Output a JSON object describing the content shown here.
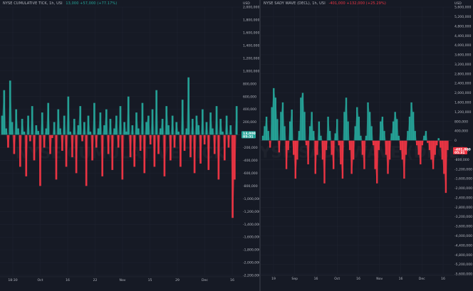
{
  "colors": {
    "up": "#26a69a",
    "down": "#f23645",
    "background": "#161a25",
    "grid": "#1f2330",
    "text": "#b2b5be"
  },
  "panes": [
    {
      "id": "left",
      "legend_name": "NYSE CUMULATIVE TICK, 1h, USI",
      "legend_values": "13,000  +57,000 (+77.17%)",
      "legend_color": "#26a69a",
      "currency": "USD",
      "watermark": "NYSE CUMULATIVE TICK",
      "price_badge": {
        "value": 13000,
        "text": "13,000",
        "sub": "05:31",
        "color": "#26a69a"
      },
      "x_ticks": [
        "18:30",
        "Oct",
        "16",
        "22",
        "Nov",
        "15",
        "29",
        "Dec",
        "16"
      ]
    },
    {
      "id": "right",
      "legend_name": "NYSE SADY WAVE (DECL), 1h, USI",
      "legend_values": "-401,000  +132,000 (+25.29%)",
      "legend_color": "#f23645",
      "currency": "USD",
      "watermark": "NYSE SADY WAVE (DECL)",
      "price_badge": {
        "value": -401000,
        "text": "-401,000",
        "sub": "05:31",
        "color": "#f23645"
      },
      "x_ticks": [
        "19",
        "Sep",
        "16",
        "Oct",
        "16",
        "Nov",
        "16",
        "Dec",
        "16"
      ]
    }
  ],
  "chart_data": [
    {
      "type": "area",
      "title": "NYSE CUMULATIVE TICK, 1h, USI",
      "ylabel": "USD",
      "ylim": [
        -2200000,
        2000000
      ],
      "y_ticks": [
        2000000,
        1800000,
        1600000,
        1400000,
        1200000,
        1000000,
        800000,
        600000,
        400000,
        200000,
        0,
        -200000,
        -400000,
        -600000,
        -800000,
        -1000000,
        -1200000,
        -1400000,
        -1600000,
        -1800000,
        -2000000,
        -2200000
      ],
      "y_tick_labels": [
        "2,000,000",
        "1,800,000",
        "1,600,000",
        "1,400,000",
        "1,200,000",
        "1,000,000",
        "800,000",
        "600,000",
        "400,000",
        "200,000",
        "0",
        "-200,000",
        "-400,000",
        "-600,000",
        "-800,000",
        "-1,000,000",
        "-1,200,000",
        "-1,400,000",
        "-1,600,000",
        "-1,800,000",
        "-2,000,000",
        "-2,200,000"
      ],
      "x_tick_labels": [
        "18:30",
        "Oct",
        "16",
        "22",
        "Nov",
        "15",
        "29",
        "Dec",
        "16"
      ],
      "series": [
        {
          "values": [
            300000,
            700000,
            100000,
            -200000,
            850000,
            200000,
            -300000,
            400000,
            100000,
            -500000,
            250000,
            50000,
            -650000,
            300000,
            -100000,
            450000,
            -400000,
            150000,
            60000,
            -800000,
            350000,
            -200000,
            100000,
            500000,
            -300000,
            -50000,
            200000,
            -700000,
            400000,
            100000,
            -250000,
            300000,
            -500000,
            600000,
            50000,
            -350000,
            250000,
            -600000,
            150000,
            450000,
            -100000,
            200000,
            -800000,
            300000,
            50000,
            -400000,
            500000,
            -200000,
            100000,
            350000,
            -650000,
            150000,
            400000,
            -300000,
            250000,
            -550000,
            100000,
            300000,
            -200000,
            450000,
            -700000,
            200000,
            50000,
            600000,
            -350000,
            150000,
            -500000,
            350000,
            100000,
            -250000,
            500000,
            -600000,
            200000,
            300000,
            -150000,
            400000,
            -500000,
            700000,
            -300000,
            100000,
            250000,
            -650000,
            450000,
            150000,
            -400000,
            300000,
            -200000,
            200000,
            50000,
            -500000,
            550000,
            -250000,
            100000,
            900000,
            -350000,
            250000,
            -600000,
            300000,
            150000,
            -450000,
            400000,
            -150000,
            200000,
            -550000,
            350000,
            100000,
            -300000,
            450000,
            -700000,
            250000,
            50000,
            -400000,
            300000,
            -200000,
            150000,
            -1300000,
            -700000,
            450000
          ]
        }
      ]
    },
    {
      "type": "area",
      "title": "NYSE SADY WAVE (DECL), 1h, USI",
      "ylabel": "USD",
      "ylim": [
        -5600000,
        5600000
      ],
      "y_ticks": [
        5600000,
        5200000,
        4800000,
        4400000,
        4000000,
        3600000,
        3200000,
        2800000,
        2400000,
        2000000,
        1600000,
        1200000,
        800000,
        400000,
        0,
        -400000,
        -800000,
        -1200000,
        -1600000,
        -2000000,
        -2400000,
        -2800000,
        -3200000,
        -3600000,
        -4000000,
        -4400000,
        -4800000,
        -5200000,
        -5600000
      ],
      "y_tick_labels": [
        "5,600,000",
        "5,200,000",
        "4,800,000",
        "4,400,000",
        "4,000,000",
        "3,600,000",
        "3,200,000",
        "2,800,000",
        "2,400,000",
        "2,000,000",
        "1,600,000",
        "1,200,000",
        "800,000",
        "400,000",
        "0",
        "-400,000",
        "-800,000",
        "-1,200,000",
        "-1,600,000",
        "-2,000,000",
        "-2,400,000",
        "-2,800,000",
        "-3,200,000",
        "-3,600,000",
        "-4,000,000",
        "-4,400,000",
        "-4,800,000",
        "-5,200,000",
        "-5,600,000"
      ],
      "x_tick_labels": [
        "19",
        "Sep",
        "16",
        "Oct",
        "16",
        "Nov",
        "16",
        "Dec",
        "16"
      ],
      "series": [
        {
          "values": [
            200000,
            600000,
            1000000,
            400000,
            -300000,
            1400000,
            2200000,
            1800000,
            900000,
            -500000,
            1200000,
            1600000,
            600000,
            -1200000,
            -400000,
            800000,
            1300000,
            -600000,
            -1600000,
            -800000,
            400000,
            1800000,
            2000000,
            1200000,
            -200000,
            -1000000,
            600000,
            1200000,
            400000,
            -1400000,
            -600000,
            800000,
            200000,
            -800000,
            -1800000,
            -400000,
            1000000,
            400000,
            -600000,
            -1200000,
            300000,
            900000,
            -200000,
            -1000000,
            -1600000,
            1200000,
            1800000,
            800000,
            -400000,
            -1400000,
            -800000,
            600000,
            1400000,
            1000000,
            200000,
            -600000,
            -1200000,
            200000,
            1600000,
            1200000,
            600000,
            -200000,
            -1200000,
            -1800000,
            -400000,
            800000,
            1000000,
            400000,
            -600000,
            -1400000,
            -800000,
            300000,
            800000,
            1200000,
            900000,
            200000,
            -400000,
            -800000,
            -1600000,
            -600000,
            400000,
            1000000,
            1600000,
            1200000,
            400000,
            -200000,
            -600000,
            -1000000,
            -200000,
            200000,
            400000,
            -100000,
            -400000,
            -800000,
            -1200000,
            -600000,
            -200000,
            100000,
            -300000,
            -800000,
            -1400000,
            -2200000,
            -401000
          ]
        }
      ]
    }
  ]
}
